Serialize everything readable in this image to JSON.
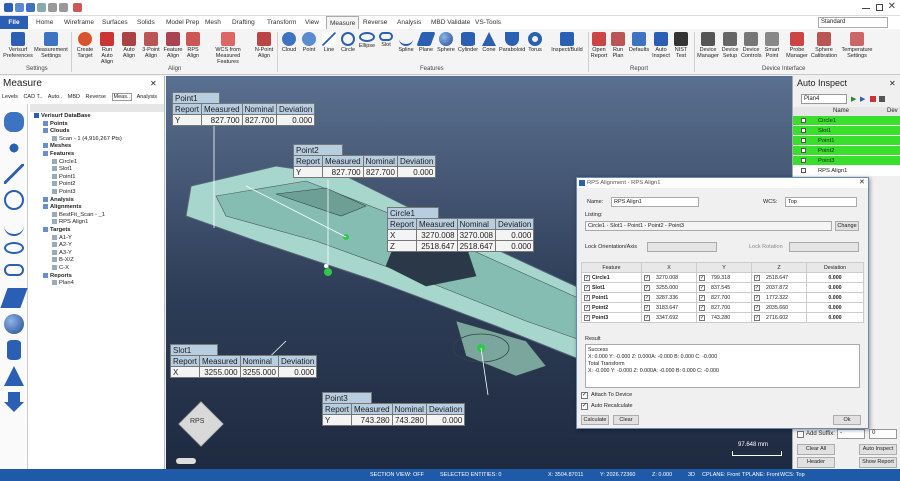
{
  "tabs": [
    "File",
    "Home",
    "Wireframe",
    "Surfaces",
    "Solids",
    "Model Prep",
    "Mesh",
    "Drafting",
    "Transform",
    "View",
    "Measure",
    "Reverse",
    "Analysis",
    "MBD Validate",
    "VS-Tools"
  ],
  "workspace": "Standard",
  "ribbon": {
    "settings": [
      "Verisurf Preferences",
      "Measurement Settings"
    ],
    "align": [
      "Create Target",
      "Run Auto Align",
      "Auto Align",
      "3-Point Align",
      "Feature Align",
      "RPS Align",
      "WCS from Measured Features",
      "N-Point Align"
    ],
    "features": [
      "Cloud",
      "Point",
      "Line",
      "Circle",
      "Ellipse",
      "Slot",
      "Spline",
      "Plane",
      "Sphere",
      "Cylinder",
      "Cone",
      "Paraboloid",
      "Torus",
      "Inspect/Build"
    ],
    "report": [
      "Open Report",
      "Run Plan",
      "Defaults",
      "Auto Inspect",
      "NIST Test"
    ],
    "device": [
      "Device Manager",
      "Device Setup",
      "Device Controls",
      "Smart Point",
      "Probe Manager",
      "Sphere Calibration",
      "Temperature Settings"
    ],
    "groups": [
      "Settings",
      "Align",
      "Features",
      "Report",
      "Device Interface"
    ]
  },
  "left": {
    "title": "Measure",
    "tabs": [
      "Levels",
      "CAD T..",
      "Auto..",
      "MBD",
      "Reverse",
      "Meas..",
      "Analysis"
    ],
    "tree": [
      {
        "label": "Verisurf DataBase",
        "indent": 0
      },
      {
        "label": "Points",
        "indent": 1
      },
      {
        "label": "Clouds",
        "indent": 1
      },
      {
        "label": "Scan - 1 (4,916,267 Pts)",
        "indent": 2
      },
      {
        "label": "Meshes",
        "indent": 1
      },
      {
        "label": "Features",
        "indent": 1
      },
      {
        "label": "Circle1",
        "indent": 2
      },
      {
        "label": "Slot1",
        "indent": 2
      },
      {
        "label": "Point1",
        "indent": 2
      },
      {
        "label": "Point2",
        "indent": 2
      },
      {
        "label": "Point3",
        "indent": 2
      },
      {
        "label": "Analysis",
        "indent": 1
      },
      {
        "label": "Alignments",
        "indent": 1
      },
      {
        "label": "BestFit_Scan - _1",
        "indent": 2
      },
      {
        "label": "RPS Align1",
        "indent": 2
      },
      {
        "label": "Targets",
        "indent": 1
      },
      {
        "label": "A1-Y",
        "indent": 2
      },
      {
        "label": "A2-Y",
        "indent": 2
      },
      {
        "label": "A3-Y",
        "indent": 2
      },
      {
        "label": "B-X/Z",
        "indent": 2
      },
      {
        "label": "C-X",
        "indent": 2
      },
      {
        "label": "Reports",
        "indent": 1
      },
      {
        "label": "Plan4",
        "indent": 2
      }
    ]
  },
  "callouts": [
    {
      "title": "Point1",
      "header": [
        "Report",
        "Measured",
        "Nominal",
        "Deviation"
      ],
      "rows": [
        [
          "Y",
          "827.700",
          "827.700",
          "0.000"
        ]
      ]
    },
    {
      "title": "Point2",
      "header": [
        "Report",
        "Measured",
        "Nominal",
        "Deviation"
      ],
      "rows": [
        [
          "Y",
          "827.700",
          "827.700",
          "0.000"
        ]
      ]
    },
    {
      "title": "Circle1",
      "header": [
        "Report",
        "Measured",
        "Nominal",
        "Deviation"
      ],
      "rows": [
        [
          "X",
          "3270.008",
          "3270.008",
          "0.000"
        ],
        [
          "Z",
          "2518.647",
          "2518.647",
          "0.000"
        ]
      ]
    },
    {
      "title": "Slot1",
      "header": [
        "Report",
        "Measured",
        "Nominal",
        "Deviation"
      ],
      "rows": [
        [
          "X",
          "3255.000",
          "3255.000",
          "0.000"
        ]
      ]
    },
    {
      "title": "Point3",
      "header": [
        "Report",
        "Measured",
        "Nominal",
        "Deviation"
      ],
      "rows": [
        [
          "Y",
          "743.280",
          "743.280",
          "0.000"
        ]
      ]
    }
  ],
  "scale": "97.648 mm",
  "view_label": "RPS",
  "right": {
    "title": "Auto Inspect",
    "plan": "Plan4",
    "col_header": "Name",
    "col_dev": "Dev",
    "items": [
      "Circle1",
      "Slot1",
      "Point1",
      "Point2",
      "Point3",
      "RPS Align1"
    ],
    "auto_suffix": "Add Suffix:",
    "suffix_val": "-",
    "suffix_num": "0",
    "buttons": [
      "Clear All",
      "Auto Inspect",
      "Header",
      "Show Report"
    ]
  },
  "dialog": {
    "title": "RPS Alignment - RPS Align1",
    "name_label": "Name:",
    "name_value": "RPS Align1",
    "wcs_label": "WCS:",
    "wcs_value": "Top",
    "listing_label": "Listing:",
    "listing_value": "Circle1 - Slot1 - Point1 - Point2 - Point3",
    "change": "Change",
    "lock_orient": "Lock Orientation/Axis",
    "lock_rot": "Lock Rotation",
    "grid_header": [
      "Feature",
      "X",
      "Y",
      "Z",
      "Deviation"
    ],
    "grid_rows": [
      [
        "Circle1",
        "3270.008",
        "799.318",
        "2518.647",
        "0.000"
      ],
      [
        "Slot1",
        "3255.000",
        "837.545",
        "2037.872",
        "0.000"
      ],
      [
        "Point1",
        "3287.336",
        "827.700",
        "1772.322",
        "0.000"
      ],
      [
        "Point2",
        "3183.647",
        "827.700",
        "2035.660",
        "0.000"
      ],
      [
        "Point3",
        "3347.692",
        "743.280",
        "2716.602",
        "0.000"
      ]
    ],
    "result_label": "Result",
    "result_text": [
      "Success",
      "X: 0.000 Y: -0.000 Z: 0.000A: -0.000 B: 0.000 C: -0.000",
      "Total Transform",
      "X: -0.000 Y: -0.000 Z: 0.000A: -0.000 B: 0.000 C: -0.000"
    ],
    "attach": "Attach To Device",
    "auto_recalc": "Auto Recalculate",
    "calculate": "Calculate",
    "clear": "Clear",
    "ok": "Ok"
  },
  "status": {
    "section": "SECTION VIEW: OFF",
    "selected": "SELECTED ENTITIES: 0",
    "x": "X:  3504.87011",
    "y": "Y:  2026.72360",
    "z": "Z: 0.000",
    "mode": "3D",
    "cplane": "CPLANE: Front",
    "tplane": "TPLANE: Front",
    "wcs": "WCS: Top"
  }
}
